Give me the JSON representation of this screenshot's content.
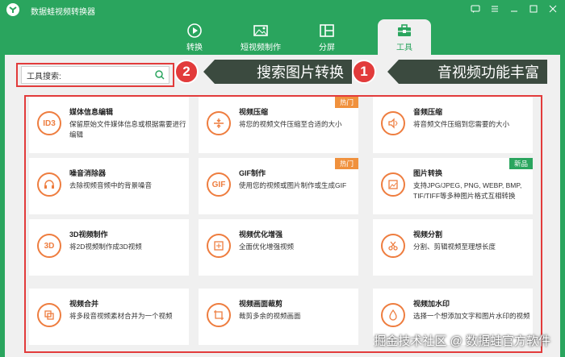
{
  "app": {
    "title": "数据蛙视频转换器"
  },
  "nav": [
    {
      "label": "转换"
    },
    {
      "label": "短视频制作"
    },
    {
      "label": "分屏"
    },
    {
      "label": "工具"
    }
  ],
  "search": {
    "label": "工具搜索:"
  },
  "callouts": [
    {
      "num": "2",
      "text": "搜索图片转换"
    },
    {
      "num": "1",
      "text": "音视频功能丰富"
    }
  ],
  "cards": [
    {
      "title": "媒体信息编辑",
      "desc": "保留原始文件媒体信息或根据需要进行编辑",
      "icon": "ID3",
      "badge": ""
    },
    {
      "title": "视频压缩",
      "desc": "将您的视频文件压缩至合适的大小",
      "icon": "compress-icon",
      "badge": "热门"
    },
    {
      "title": "音频压缩",
      "desc": "将音频文件压缩到您需要的大小",
      "icon": "audio-compress-icon",
      "badge": ""
    },
    {
      "title": "噪音消除器",
      "desc": "去除视频音频中的背景噪音",
      "icon": "headphone-icon",
      "badge": ""
    },
    {
      "title": "GIF制作",
      "desc": "使用您的视频或图片制作或生成GIF",
      "icon": "GIF",
      "badge": "热门"
    },
    {
      "title": "图片转换",
      "desc": "支持JPG/JPEG, PNG, WEBP, BMP, TIF/TIFF等多种图片格式互相转换",
      "icon": "image-convert-icon",
      "badge": "新品"
    },
    {
      "title": "3D视频制作",
      "desc": "将2D视频制作成3D视频",
      "icon": "3D",
      "badge": ""
    },
    {
      "title": "视频优化增强",
      "desc": "全面优化增强视频",
      "icon": "enhance-icon",
      "badge": ""
    },
    {
      "title": "视频分割",
      "desc": "分割、剪辑视频至理想长度",
      "icon": "scissors-icon",
      "badge": ""
    },
    {
      "title": "视频合并",
      "desc": "将多段音视频素材合并为一个视频",
      "icon": "merge-icon",
      "badge": ""
    },
    {
      "title": "视频画面裁剪",
      "desc": "裁剪多余的视频画面",
      "icon": "crop-icon",
      "badge": ""
    },
    {
      "title": "视频加水印",
      "desc": "选择一个想添加文字和图片水印的视频",
      "icon": "watermark-icon",
      "badge": ""
    }
  ],
  "watermark": "掘金技术社区 @ 数据蛙官方软件",
  "colors": {
    "accent": "#2aa55e",
    "icon": "#ee7d3f",
    "highlight": "#e23b3b",
    "hot": "#f0913d"
  }
}
